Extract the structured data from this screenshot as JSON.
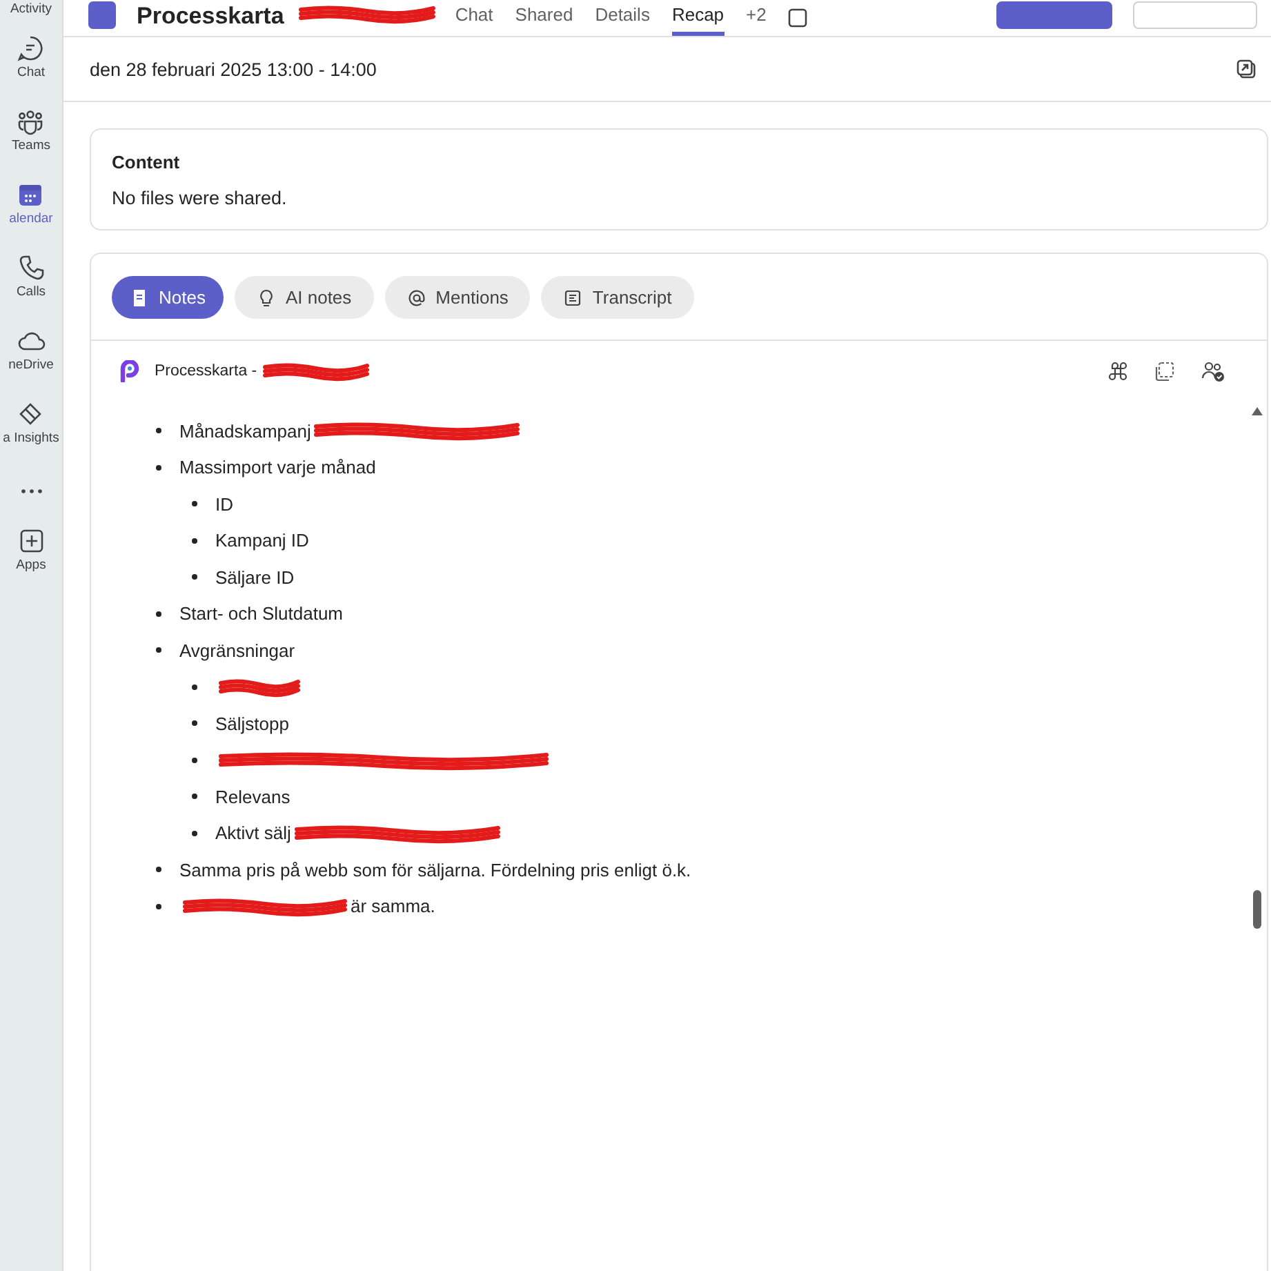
{
  "rail": [
    {
      "label": "Activity",
      "selected": false
    },
    {
      "label": "Chat",
      "selected": false
    },
    {
      "label": "Teams",
      "selected": false
    },
    {
      "label": "alendar",
      "selected": true
    },
    {
      "label": "Calls",
      "selected": false
    },
    {
      "label": "neDrive",
      "selected": false
    },
    {
      "label": "a Insights",
      "selected": false
    },
    {
      "selected": false
    },
    {
      "label": "Apps",
      "selected": false
    }
  ],
  "header": {
    "title": "Processkarta",
    "tabs": [
      {
        "label": "Chat",
        "selected": false
      },
      {
        "label": "Shared",
        "selected": false
      },
      {
        "label": "Details",
        "selected": false
      },
      {
        "label": "Recap",
        "selected": true
      },
      {
        "label": "+2",
        "selected": false
      }
    ],
    "buttons": [
      {
        "kind": "primary"
      },
      {
        "kind": "secondary"
      }
    ]
  },
  "meeting_time": "den 28 februari 2025 13:00 - 14:00",
  "content": {
    "title": "Content",
    "text": "No files were shared."
  },
  "recap_tabs": [
    {
      "label": "Notes",
      "selected": true
    },
    {
      "label": "AI notes",
      "selected": false
    },
    {
      "label": "Mentions",
      "selected": false
    },
    {
      "label": "Transcript",
      "selected": false
    }
  ],
  "notes": {
    "title": "Processkarta -",
    "items": [
      {
        "text": "Månadskampanj",
        "kind": "tail"
      },
      {
        "text": "Massimport varje månad",
        "children": [
          {
            "text": "ID"
          },
          {
            "text": "Kampanj ID"
          },
          {
            "text": "Säljare ID"
          }
        ]
      },
      {
        "text": "Start- och Slutdatum"
      },
      {
        "text": "Avgränsningar",
        "children": [
          {
            "kind": "hidden"
          },
          {
            "text": "Säljstopp"
          },
          {
            "kind": "hiddenlong"
          },
          {
            "text": "Relevans"
          },
          {
            "text": "Aktivt sälj",
            "kind": "tail"
          }
        ]
      },
      {
        "text": "Samma pris på webb som för säljarna. Fördelning pris enligt ö.k."
      },
      {
        "text": "är samma.",
        "kind": "lead"
      }
    ]
  }
}
